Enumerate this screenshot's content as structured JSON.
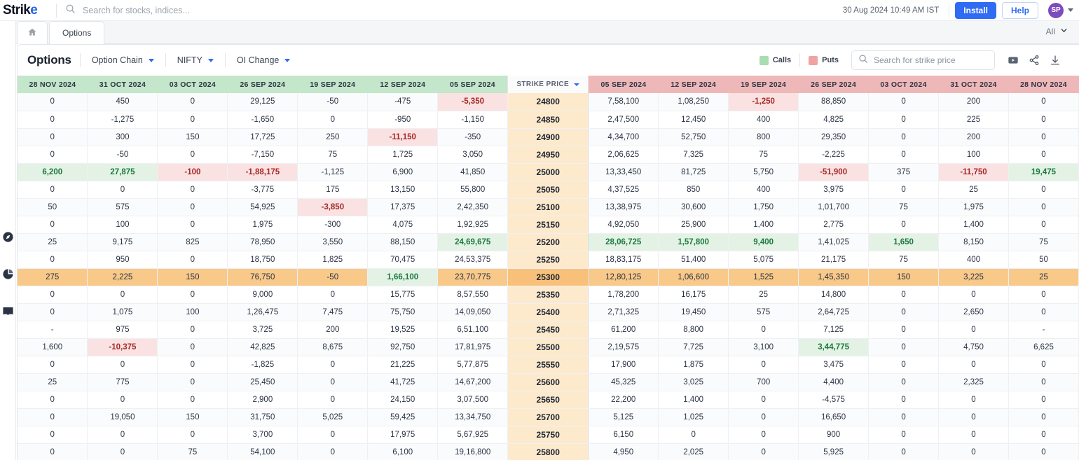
{
  "app": {
    "brand": "Strike",
    "brand_prefix": "Strik",
    "brand_accent": "e"
  },
  "global_search": {
    "placeholder": "Search for stocks, indices...",
    "icon": "search-icon"
  },
  "header": {
    "timestamp": "30 Aug 2024 10:49 AM IST",
    "install_label": "Install",
    "help_label": "Help",
    "avatar_initials": "SP"
  },
  "tabs": {
    "home_icon": "home-icon",
    "items": [
      {
        "label": "Options",
        "active": true
      }
    ],
    "right_filter_label": "All"
  },
  "rail": {
    "icons": [
      "compass-icon",
      "pie-chart-icon",
      "book-icon"
    ]
  },
  "toolbar": {
    "title": "Options",
    "dropdowns": [
      {
        "label": "Option Chain"
      },
      {
        "label": "NIFTY"
      },
      {
        "label": "OI Change"
      }
    ],
    "legend": [
      {
        "label": "Calls",
        "color": "#a8ddb2"
      },
      {
        "label": "Puts",
        "color": "#efa3a3"
      }
    ],
    "strike_search_placeholder": "Search for strike price",
    "icons": [
      "video-icon",
      "share-icon",
      "download-icon"
    ]
  },
  "chart_data": {
    "type": "table",
    "title": "Options — Option Chain — NIFTY — OI Change",
    "strike_header": "STRIKE PRICE",
    "call_columns": [
      "28 NOV 2024",
      "31 OCT 2024",
      "03 OCT 2024",
      "26 SEP 2024",
      "19 SEP 2024",
      "12 SEP 2024",
      "05 SEP 2024"
    ],
    "put_columns": [
      "05 SEP 2024",
      "12 SEP 2024",
      "19 SEP 2024",
      "26 SEP 2024",
      "03 OCT 2024",
      "31 OCT 2024",
      "28 NOV 2024"
    ],
    "atm_strike": "25300",
    "rows": [
      {
        "strike": "24800",
        "calls": [
          "0",
          "450",
          "0",
          "29,125",
          "-50",
          "-475",
          "-5,350"
        ],
        "calls_hl": [
          "",
          "",
          "",
          "",
          "",
          "",
          "neg"
        ],
        "puts": [
          "7,58,100",
          "1,08,250",
          "-1,250",
          "88,850",
          "0",
          "200",
          "0"
        ],
        "puts_hl": [
          "",
          "",
          "neg",
          "",
          "",
          "",
          ""
        ]
      },
      {
        "strike": "24850",
        "calls": [
          "0",
          "-1,275",
          "0",
          "-1,650",
          "0",
          "-950",
          "-1,150"
        ],
        "calls_hl": [
          "",
          "",
          "",
          "",
          "",
          "",
          ""
        ],
        "puts": [
          "2,47,500",
          "12,450",
          "400",
          "4,825",
          "0",
          "225",
          "0"
        ],
        "puts_hl": [
          "",
          "",
          "",
          "",
          "",
          "",
          ""
        ]
      },
      {
        "strike": "24900",
        "calls": [
          "0",
          "300",
          "150",
          "17,725",
          "250",
          "-11,150",
          "-350"
        ],
        "calls_hl": [
          "",
          "",
          "",
          "",
          "",
          "neg",
          ""
        ],
        "puts": [
          "4,34,700",
          "52,750",
          "800",
          "29,350",
          "0",
          "200",
          "0"
        ],
        "puts_hl": [
          "",
          "",
          "",
          "",
          "",
          "",
          ""
        ]
      },
      {
        "strike": "24950",
        "calls": [
          "0",
          "-50",
          "0",
          "-7,150",
          "75",
          "1,725",
          "3,050"
        ],
        "calls_hl": [
          "",
          "",
          "",
          "",
          "",
          "",
          ""
        ],
        "puts": [
          "2,06,625",
          "7,325",
          "75",
          "-2,225",
          "0",
          "100",
          "0"
        ],
        "puts_hl": [
          "",
          "",
          "",
          "",
          "",
          "",
          ""
        ]
      },
      {
        "strike": "25000",
        "calls": [
          "6,200",
          "27,875",
          "-100",
          "-1,88,175",
          "-1,125",
          "6,900",
          "41,850"
        ],
        "calls_hl": [
          "pos",
          "pos",
          "neg",
          "neg",
          "",
          "",
          ""
        ],
        "puts": [
          "13,33,450",
          "81,725",
          "5,750",
          "-51,900",
          "375",
          "-11,750",
          "19,475"
        ],
        "puts_hl": [
          "",
          "",
          "",
          "neg",
          "",
          "neg",
          "pos"
        ]
      },
      {
        "strike": "25050",
        "calls": [
          "0",
          "0",
          "0",
          "-3,775",
          "175",
          "13,150",
          "55,800"
        ],
        "calls_hl": [
          "",
          "",
          "",
          "",
          "",
          "",
          ""
        ],
        "puts": [
          "4,37,525",
          "850",
          "400",
          "3,975",
          "0",
          "25",
          "0"
        ],
        "puts_hl": [
          "",
          "",
          "",
          "",
          "",
          "",
          ""
        ]
      },
      {
        "strike": "25100",
        "calls": [
          "50",
          "575",
          "0",
          "54,925",
          "-3,850",
          "17,375",
          "2,42,350"
        ],
        "calls_hl": [
          "",
          "",
          "",
          "",
          "neg",
          "",
          ""
        ],
        "puts": [
          "13,38,975",
          "30,600",
          "1,750",
          "1,01,700",
          "75",
          "1,975",
          "0"
        ],
        "puts_hl": [
          "",
          "",
          "",
          "",
          "",
          "",
          ""
        ]
      },
      {
        "strike": "25150",
        "calls": [
          "0",
          "100",
          "0",
          "1,975",
          "-300",
          "4,075",
          "1,92,925"
        ],
        "calls_hl": [
          "",
          "",
          "",
          "",
          "",
          "",
          ""
        ],
        "puts": [
          "4,92,050",
          "25,900",
          "1,400",
          "2,775",
          "0",
          "1,400",
          "0"
        ],
        "puts_hl": [
          "",
          "",
          "",
          "",
          "",
          "",
          ""
        ]
      },
      {
        "strike": "25200",
        "calls": [
          "25",
          "9,175",
          "825",
          "78,950",
          "3,550",
          "88,150",
          "24,69,675"
        ],
        "calls_hl": [
          "",
          "",
          "",
          "",
          "",
          "",
          "pos"
        ],
        "puts": [
          "28,06,725",
          "1,57,800",
          "9,400",
          "1,41,025",
          "1,650",
          "8,150",
          "75"
        ],
        "puts_hl": [
          "pos",
          "pos",
          "pos",
          "",
          "pos",
          "",
          ""
        ]
      },
      {
        "strike": "25250",
        "calls": [
          "0",
          "950",
          "0",
          "18,750",
          "1,825",
          "70,475",
          "24,53,375"
        ],
        "calls_hl": [
          "",
          "",
          "",
          "",
          "",
          "",
          ""
        ],
        "puts": [
          "18,83,175",
          "51,400",
          "5,075",
          "21,175",
          "75",
          "400",
          "50"
        ],
        "puts_hl": [
          "",
          "",
          "",
          "",
          "",
          "",
          ""
        ]
      },
      {
        "strike": "25300",
        "atm": true,
        "calls": [
          "275",
          "2,225",
          "150",
          "76,750",
          "-50",
          "1,66,100",
          "23,70,775"
        ],
        "calls_hl": [
          "",
          "",
          "",
          "",
          "",
          "pos",
          ""
        ],
        "puts": [
          "12,80,125",
          "1,06,600",
          "1,525",
          "1,45,350",
          "150",
          "3,225",
          "25"
        ],
        "puts_hl": [
          "",
          "",
          "",
          "",
          "",
          "",
          ""
        ]
      },
      {
        "strike": "25350",
        "calls": [
          "0",
          "0",
          "0",
          "9,000",
          "0",
          "15,775",
          "8,57,550"
        ],
        "calls_hl": [
          "",
          "",
          "",
          "",
          "",
          "",
          ""
        ],
        "puts": [
          "1,78,200",
          "16,175",
          "25",
          "14,800",
          "0",
          "0",
          "0"
        ],
        "puts_hl": [
          "",
          "",
          "",
          "",
          "",
          "",
          ""
        ]
      },
      {
        "strike": "25400",
        "calls": [
          "0",
          "1,075",
          "100",
          "1,26,475",
          "7,475",
          "75,750",
          "14,09,050"
        ],
        "calls_hl": [
          "",
          "",
          "",
          "",
          "",
          "",
          ""
        ],
        "puts": [
          "2,71,325",
          "19,450",
          "575",
          "2,64,725",
          "0",
          "2,650",
          "0"
        ],
        "puts_hl": [
          "",
          "",
          "",
          "",
          "",
          "",
          ""
        ]
      },
      {
        "strike": "25450",
        "calls": [
          "-",
          "975",
          "0",
          "3,725",
          "200",
          "19,525",
          "6,51,100"
        ],
        "calls_hl": [
          "",
          "",
          "",
          "",
          "",
          "",
          ""
        ],
        "puts": [
          "61,200",
          "8,800",
          "0",
          "7,125",
          "0",
          "0",
          "-"
        ],
        "puts_hl": [
          "",
          "",
          "",
          "",
          "",
          "",
          ""
        ]
      },
      {
        "strike": "25500",
        "calls": [
          "1,600",
          "-10,375",
          "0",
          "42,825",
          "8,675",
          "92,750",
          "17,81,975"
        ],
        "calls_hl": [
          "",
          "neg",
          "",
          "",
          "",
          "",
          ""
        ],
        "puts": [
          "2,19,575",
          "7,725",
          "3,100",
          "3,44,775",
          "0",
          "4,750",
          "6,625"
        ],
        "puts_hl": [
          "",
          "",
          "",
          "pos",
          "",
          "",
          ""
        ]
      },
      {
        "strike": "25550",
        "calls": [
          "0",
          "0",
          "0",
          "-1,825",
          "0",
          "21,225",
          "5,77,875"
        ],
        "calls_hl": [
          "",
          "",
          "",
          "",
          "",
          "",
          ""
        ],
        "puts": [
          "17,900",
          "1,875",
          "0",
          "3,475",
          "0",
          "0",
          "0"
        ],
        "puts_hl": [
          "",
          "",
          "",
          "",
          "",
          "",
          ""
        ]
      },
      {
        "strike": "25600",
        "calls": [
          "25",
          "775",
          "0",
          "25,450",
          "0",
          "41,725",
          "14,67,200"
        ],
        "calls_hl": [
          "",
          "",
          "",
          "",
          "",
          "",
          ""
        ],
        "puts": [
          "45,325",
          "3,025",
          "700",
          "4,400",
          "0",
          "2,325",
          "0"
        ],
        "puts_hl": [
          "",
          "",
          "",
          "",
          "",
          "",
          ""
        ]
      },
      {
        "strike": "25650",
        "calls": [
          "0",
          "0",
          "0",
          "2,900",
          "0",
          "24,150",
          "3,07,500"
        ],
        "calls_hl": [
          "",
          "",
          "",
          "",
          "",
          "",
          ""
        ],
        "puts": [
          "22,200",
          "1,400",
          "0",
          "-4,575",
          "0",
          "0",
          "0"
        ],
        "puts_hl": [
          "",
          "",
          "",
          "",
          "",
          "",
          ""
        ]
      },
      {
        "strike": "25700",
        "calls": [
          "0",
          "19,050",
          "150",
          "31,750",
          "5,025",
          "59,425",
          "13,34,750"
        ],
        "calls_hl": [
          "",
          "",
          "",
          "",
          "",
          "",
          ""
        ],
        "puts": [
          "5,125",
          "1,025",
          "0",
          "16,650",
          "0",
          "0",
          "0"
        ],
        "puts_hl": [
          "",
          "",
          "",
          "",
          "",
          "",
          ""
        ]
      },
      {
        "strike": "25750",
        "calls": [
          "0",
          "0",
          "0",
          "3,700",
          "0",
          "17,975",
          "5,67,925"
        ],
        "calls_hl": [
          "",
          "",
          "",
          "",
          "",
          "",
          ""
        ],
        "puts": [
          "6,150",
          "0",
          "0",
          "900",
          "0",
          "0",
          "0"
        ],
        "puts_hl": [
          "",
          "",
          "",
          "",
          "",
          "",
          ""
        ]
      },
      {
        "strike": "25800",
        "calls": [
          "0",
          "0",
          "75",
          "54,100",
          "0",
          "6,100",
          "19,16,800"
        ],
        "calls_hl": [
          "",
          "",
          "",
          "",
          "",
          "",
          ""
        ],
        "puts": [
          "4,950",
          "2,025",
          "0",
          "5,925",
          "0",
          "0",
          "0"
        ],
        "puts_hl": [
          "",
          "",
          "",
          "",
          "",
          "",
          ""
        ]
      }
    ]
  }
}
